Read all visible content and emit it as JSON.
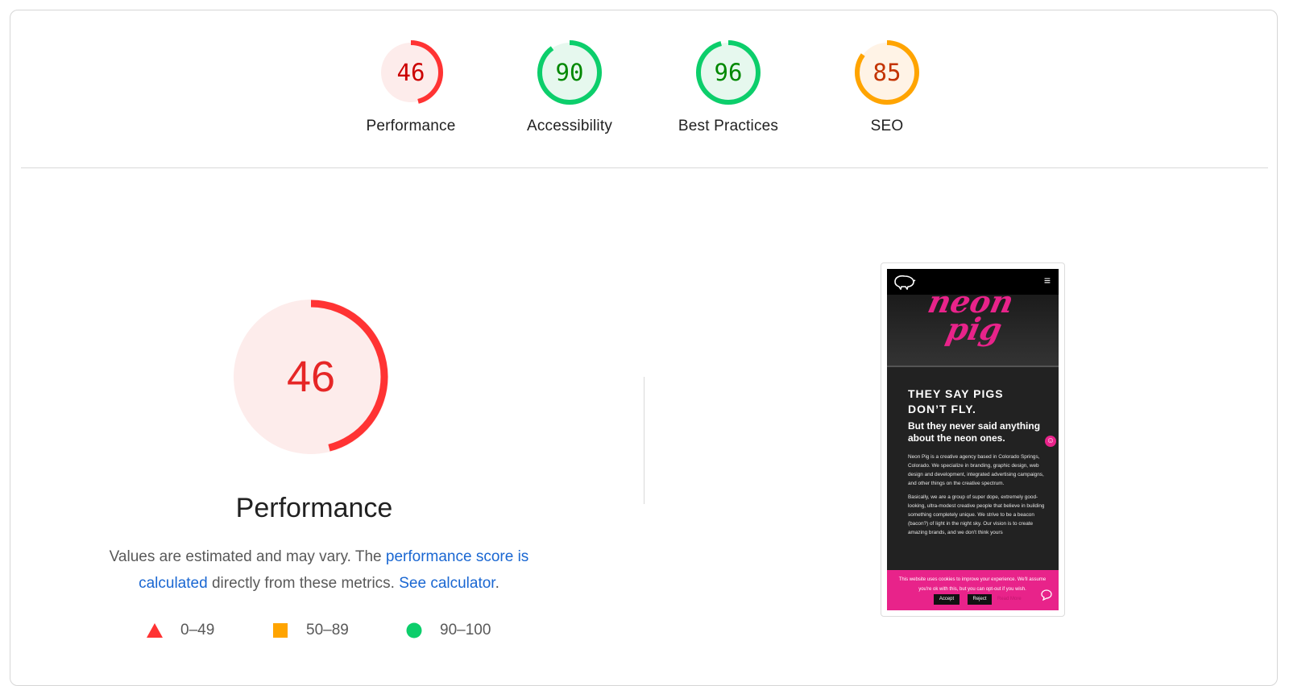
{
  "summary_gauges": [
    {
      "score": "46",
      "label": "Performance",
      "fraction": 0.46,
      "color": "#f33",
      "bg": "#fdeceb",
      "text_color": "#c00"
    },
    {
      "score": "90",
      "label": "Accessibility",
      "fraction": 0.9,
      "color": "#0cce6b",
      "bg": "#e6f8ee",
      "text_color": "#080"
    },
    {
      "score": "96",
      "label": "Best Practices",
      "fraction": 0.96,
      "color": "#0cce6b",
      "bg": "#e6f8ee",
      "text_color": "#080"
    },
    {
      "score": "85",
      "label": "SEO",
      "fraction": 0.85,
      "color": "#ffa400",
      "bg": "#fff3e6",
      "text_color": "#c33300"
    }
  ],
  "performance": {
    "score": "46",
    "fraction": 0.46,
    "title": "Performance",
    "desc_prefix": "Values are estimated and may vary. The ",
    "link_score": "performance score is calculated",
    "desc_middle": " directly from these metrics. ",
    "link_calc": "See calculator",
    "desc_suffix": "."
  },
  "legend": [
    {
      "label": "0–49",
      "icon": "triangle-icon",
      "color": "#f33"
    },
    {
      "label": "50–89",
      "icon": "square-icon",
      "color": "#ffa400"
    },
    {
      "label": "90–100",
      "icon": "circle-icon",
      "color": "#0cce6b"
    }
  ],
  "screenshot": {
    "hero_text_1": "neon",
    "hero_text_2": "pig",
    "headline": "THEY SAY PIGS DON’T FLY.",
    "subhead": "But they never said anything about the neon ones.",
    "para1": "Neon Pig is a creative agency based in Colorado Springs, Colorado. We specialize in branding, graphic design, web design and development, integrated advertising campaigns, and other things on the creative spectrum.",
    "para2": "Basically, we are a group of super dope, extremely good-looking, ultra-modest creative people that believe in building something completely unique. We strive to be a beacon (bacon?) of light in the night sky. Our vision is to create amazing brands, and we don't think yours",
    "cookie_text": "This website uses cookies to improve your experience. We'll assume you're ok with this, but you can opt-out if you wish.",
    "accept": "Accept",
    "reject": "Reject",
    "read_more": "Read More",
    "menu": "≡"
  }
}
